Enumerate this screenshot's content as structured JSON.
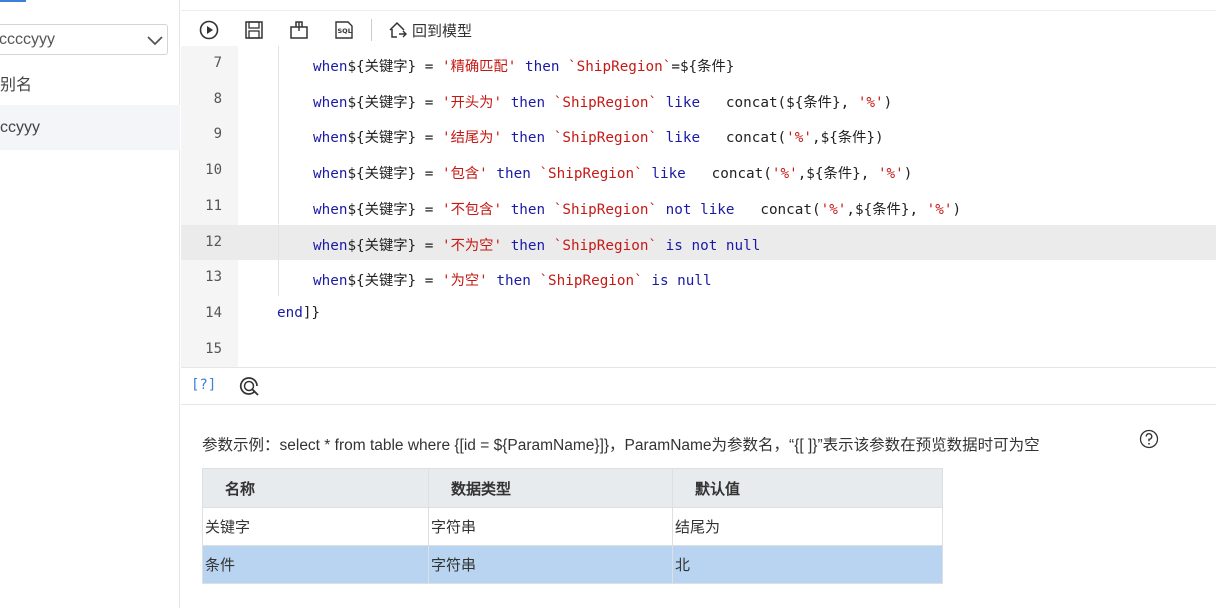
{
  "left": {
    "select_value": "ccccyyy",
    "alias_label": "别名",
    "selected_label": "ccyyy"
  },
  "toolbar": {
    "back_label": "回到模型",
    "sql_icon_text": "SQL"
  },
  "editor": {
    "lines": [
      {
        "num": "7",
        "tokens": [
          [
            "kw",
            "when"
          ],
          [
            "",
            "${关键字} = "
          ],
          [
            "str",
            "'精确匹配'"
          ],
          [
            "kw",
            " then"
          ],
          [
            "str",
            " `ShipRegion`"
          ],
          [
            "",
            "=${条件}"
          ]
        ]
      },
      {
        "num": "8",
        "tokens": [
          [
            "kw",
            "when"
          ],
          [
            "",
            "${关键字} = "
          ],
          [
            "str",
            "'开头为'"
          ],
          [
            "kw",
            " then"
          ],
          [
            "str",
            " `ShipRegion`"
          ],
          [
            "kw",
            " like"
          ],
          [
            "",
            "   concat(${条件}, "
          ],
          [
            "str",
            "'%'"
          ],
          [
            "",
            ")"
          ]
        ]
      },
      {
        "num": "9",
        "tokens": [
          [
            "kw",
            "when"
          ],
          [
            "",
            "${关键字} = "
          ],
          [
            "str",
            "'结尾为'"
          ],
          [
            "kw",
            " then"
          ],
          [
            "str",
            " `ShipRegion`"
          ],
          [
            "kw",
            " like"
          ],
          [
            "",
            "   concat("
          ],
          [
            "str",
            "'%'"
          ],
          [
            "",
            ",${条件})"
          ]
        ]
      },
      {
        "num": "10",
        "tokens": [
          [
            "kw",
            "when"
          ],
          [
            "",
            "${关键字} = "
          ],
          [
            "str",
            "'包含'"
          ],
          [
            "kw",
            " then"
          ],
          [
            "str",
            " `ShipRegion`"
          ],
          [
            "kw",
            " like"
          ],
          [
            "",
            "   concat("
          ],
          [
            "str",
            "'%'"
          ],
          [
            "",
            ",${条件}, "
          ],
          [
            "str",
            "'%'"
          ],
          [
            "",
            ")"
          ]
        ]
      },
      {
        "num": "11",
        "tokens": [
          [
            "kw",
            "when"
          ],
          [
            "",
            "${关键字} = "
          ],
          [
            "str",
            "'不包含'"
          ],
          [
            "kw",
            " then"
          ],
          [
            "str",
            " `ShipRegion`"
          ],
          [
            "kw",
            " not like"
          ],
          [
            "",
            "   concat("
          ],
          [
            "str",
            "'%'"
          ],
          [
            "",
            ",${条件}, "
          ],
          [
            "str",
            "'%'"
          ],
          [
            "",
            ")"
          ]
        ]
      },
      {
        "num": "12",
        "active": true,
        "tokens": [
          [
            "kw",
            "when"
          ],
          [
            "",
            "${关键字} = "
          ],
          [
            "str",
            "'不为空'"
          ],
          [
            "kw",
            " then"
          ],
          [
            "str",
            " `ShipRegion`"
          ],
          [
            "kw",
            " is not null"
          ]
        ]
      },
      {
        "num": "13",
        "tokens": [
          [
            "kw",
            "when"
          ],
          [
            "",
            "${关键字} = "
          ],
          [
            "str",
            "'为空'"
          ],
          [
            "kw",
            " then"
          ],
          [
            "str",
            " `ShipRegion`"
          ],
          [
            "kw",
            " is null"
          ]
        ]
      },
      {
        "num": "14",
        "end": true,
        "tokens": [
          [
            "kw",
            "end"
          ],
          [
            "",
            "]}"
          ]
        ]
      },
      {
        "num": "15",
        "tokens": []
      }
    ]
  },
  "bottombar": {
    "help_link": "[?]"
  },
  "params": {
    "hint": "参数示例：select * from table where {[id = ${ParamName}]}，ParamName为参数名，“{[ ]}”表示该参数在预览数据时可为空",
    "columns": [
      "名称",
      "数据类型",
      "默认值"
    ],
    "rows": [
      {
        "name": "关键字",
        "type": "字符串",
        "default": "结尾为",
        "selected": false
      },
      {
        "name": "条件",
        "type": "字符串",
        "default": "北",
        "selected": true
      }
    ]
  }
}
